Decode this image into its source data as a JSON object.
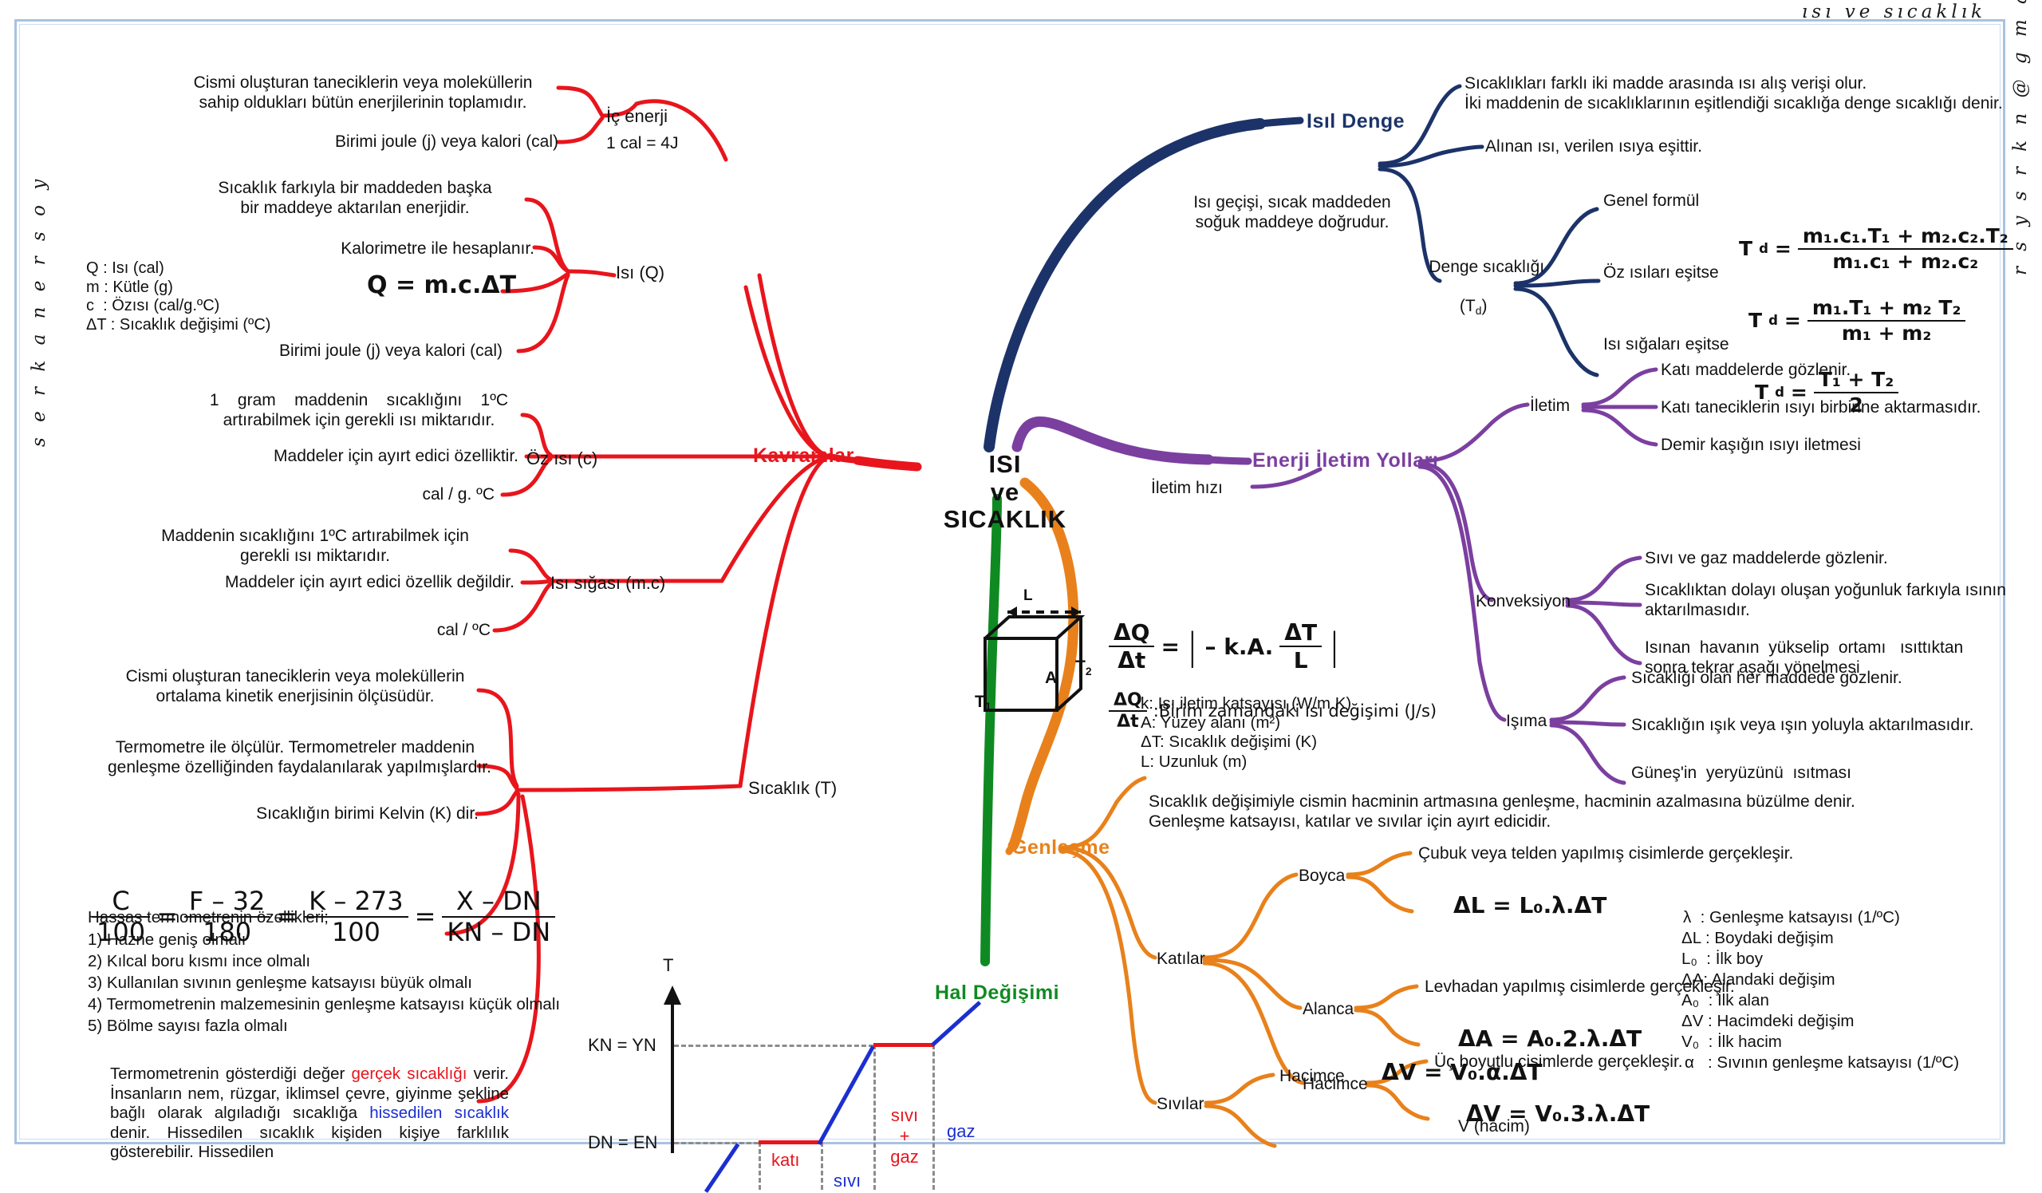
{
  "watermarks": {
    "top_right": "ısı  ve  sıcaklık",
    "left": "s e r k a n   e r s o y",
    "right": "r s y s r k n @ g m a i l . c o m"
  },
  "center": {
    "line1": "ISI",
    "line2": "ve",
    "line3": "SICAKLIK"
  },
  "branches": {
    "kavramlar": "Kavramlar",
    "isil_denge": "Isıl Denge",
    "enerji_iletim": "Enerji İletim Yolları",
    "genlesme": "Genleşme",
    "hal_degisimi": "Hal Değişimi"
  },
  "kavramlar": {
    "ic_enerji": {
      "label": "İç enerji",
      "sub": "1 cal = 4J",
      "desc1": "Cismi oluşturan taneciklerin veya moleküllerin\nsahip oldukları bütün enerjilerinin toplamıdır.",
      "desc2": "Birimi joule (j) veya kalori (cal)"
    },
    "isi_q": {
      "label": "Isı (Q)",
      "desc1": "Sıcaklık farkıyla bir maddeden başka\nbir maddeye aktarılan enerjidir.",
      "desc2": "Kalorimetre ile hesaplanır.",
      "desc3": "Birimi joule (j) veya kalori (cal)",
      "formula": "Q = m.c.ΔT",
      "legend": "Q : Isı (cal)\nm : Kütle (g)\nc  : Özısı (cal/g.ºC)\nΔT : Sıcaklık değişimi (ºC)"
    },
    "oz_isi": {
      "label": "Öz ısı (c)",
      "desc1": "1    gram    maddenin    sıcaklığını    1ºC\nartırabilmek için gerekli ısı miktarıdır.",
      "desc2": "Maddeler için ayırt edici özelliktir.",
      "desc3": "cal / g. ºC"
    },
    "isi_sigasi": {
      "label": "Isı sığası (m.c)",
      "desc1": "Maddenin sıcaklığını 1ºC artırabilmek için\ngerekli ısı miktarıdır.",
      "desc2": "Maddeler için ayırt edici özellik değildir.",
      "desc3": "cal / ºC"
    },
    "sicaklik_t": {
      "label": "Sıcaklık (T)",
      "desc1": "Cismi oluşturan taneciklerin veya moleküllerin\nortalama kinetik enerjisinin ölçüsüdür.",
      "desc2": "Termometre ile ölçülür. Termometreler maddenin\ngenleşme özelliğinden faydalanılarak yapılmışlardır.",
      "desc3": "Sıcaklığın birimi Kelvin (K) dir.",
      "scale_formula": {
        "n1": "C",
        "d1": "100",
        "n2": "F – 32",
        "d2": "180",
        "n3": "K – 273",
        "d3": "100",
        "n4": "X – DN",
        "d4": "KN – DN"
      },
      "props_title": "Hassas termometrenin özellikleri;",
      "props": [
        "1) Hazne geniş olmalı",
        "2) Kılcal boru kısmı ince olmalı",
        "3) Kullanılan sıvının genleşme katsayısı büyük olmalı",
        "4) Termometrenin malzemesinin genleşme katsayısı küçük olmalı",
        "5) Bölme sayısı fazla olmalı"
      ],
      "para": {
        "p1": "Termometrenin gösterdiği değer ",
        "hl1": "gerçek sıcaklığı",
        "p2": " verir. İnsanların nem, rüzgar, iklimsel çevre, giyinme şekline bağlı olarak algıladığı sıcaklığa ",
        "hl2": "hissedilen sıcaklık",
        "p3": " denir. Hissedilen sıcaklık kişiden kişiye farklılık gösterebilir. Hissedilen"
      }
    }
  },
  "isil_denge": {
    "desc_left": "Isı geçişi, sıcak maddeden\nsoğuk maddeye doğrudur.",
    "item1": "Sıcaklıkları farklı iki madde arasında ısı alış verişi olur.\nİki maddenin de sıcaklıklarının eşitlendiği sıcaklığa denge sıcaklığı denir.",
    "item2": "Alınan ısı, verilen ısıya eşittir.",
    "denge_label1": "Denge sıcaklığı",
    "denge_label2": "(T",
    "denge_label2b": "d",
    "denge_label2c": ")",
    "rows": [
      {
        "label": "Genel formül",
        "lhs": "T",
        "sub": "d",
        "num": "m₁.c₁.T₁ + m₂.c₂.T₂",
        "den": "m₁.c₁ + m₂.c₂"
      },
      {
        "label": "Öz ısıları eşitse",
        "lhs": "T",
        "sub": "d",
        "num": "m₁.T₁ + m₂ T₂",
        "den": "m₁ + m₂"
      },
      {
        "label": "Isı sığaları eşitse",
        "lhs": "T",
        "sub": "d",
        "num": "T₁ + T₂",
        "den": "2"
      }
    ]
  },
  "enerji_iletim": {
    "iletim_hizi": "İletim hızı",
    "rate_formula": {
      "n1": "ΔQ",
      "d1": "Δt",
      "eq": "=",
      "bar": "|",
      "body": "– k.A.",
      "n2": "ΔT",
      "d2": "L"
    },
    "explain_head_n": "ΔQ",
    "explain_head_d": "Δt",
    "explain_head_txt": ":Birim zamandaki ısı değişimi (J/s)",
    "explain_list": "k: Isı iletim katsayısı (W/m.K)\nA: Yüzey alanı (m²)\nΔT: Sıcaklık değişimi (K)\nL: Uzunluk (m)",
    "cube": {
      "L": "L",
      "A": "A",
      "T1": "T",
      "T1s": "1",
      "T2": "T",
      "T2s": "2"
    },
    "nodes": [
      {
        "label": "İletim",
        "items": [
          "Katı maddelerde gözlenir.",
          "Katı taneciklerin ısıyı birbirine aktarmasıdır.",
          "Demir kaşığın ısıyı iletmesi"
        ]
      },
      {
        "label": "Konveksiyon",
        "items": [
          "Sıvı ve gaz maddelerde gözlenir.",
          "Sıcaklıktan dolayı oluşan yoğunluk farkıyla ısının\naktarılmasıdır.",
          "Isınan  havanın  yükselip  ortamı   ısıttıktan\nsonra tekrar aşağı yönelmesi"
        ]
      },
      {
        "label": "Işıma",
        "items": [
          "Sıcaklığı olan her maddede gözlenir.",
          "Sıcaklığın ışık veya ışın yoluyla aktarılmasıdır.",
          "Güneş'in  yeryüzünü  ısıtması"
        ]
      }
    ]
  },
  "genlesme": {
    "intro": "Sıcaklık değişimiyle cismin hacminin artmasına genleşme, hacminin azalmasına büzülme denir.\nGenleşme katsayısı, katılar ve sıvılar için ayırt edicidir.",
    "katilar": "Katılar",
    "sivilar": "Sıvılar",
    "items": [
      {
        "label": "Boyca",
        "desc": "Çubuk veya telden yapılmış cisimlerde gerçekleşir.",
        "formula": "ΔL = L₀.λ.ΔT"
      },
      {
        "label": "Alanca",
        "desc": "Levhadan yapılmış cisimlerde gerçekleşir.",
        "formula": "ΔA = A₀.2.λ.ΔT"
      },
      {
        "label": "Hacimce",
        "desc": "Üç boyutlu cisimlerde gerçekleşir.",
        "formula": "ΔV = V₀.3.λ.ΔT"
      }
    ],
    "sivi_item": {
      "label": "Hacimce",
      "formula": "ΔV = V₀.α.ΔT",
      "note": "V (hacim)"
    },
    "legend": [
      "λ  : Genleşme katsayısı (1/ºC)",
      "ΔL : Boydaki değişim",
      "L₀  : İlk boy",
      "ΔA: Alandaki değişim",
      "A₀  : İlk alan",
      "ΔV : Hacimdeki değişim",
      "V₀  : İlk hacim",
      "α   : Sıvının genleşme katsayısı (1/ºC)"
    ]
  },
  "chart_data": {
    "type": "line",
    "title": "Hal Değişimi",
    "ylabel": "T",
    "xlabel": "",
    "grid": false,
    "ytick_labels": [
      "DN = EN",
      "KN = YN"
    ],
    "ytick_values": [
      1,
      2
    ],
    "segments": [
      {
        "phase": "katı-ısınma",
        "color": "#1b2fd0",
        "x0": 0.0,
        "y0": 0.2,
        "x1": 0.12,
        "y1": 1.0
      },
      {
        "phase": "katı (erime)",
        "color": "#e8151c",
        "x0": 0.12,
        "y0": 1.0,
        "x1": 0.38,
        "y1": 1.0
      },
      {
        "phase": "sıvı-ısınma",
        "color": "#1b2fd0",
        "x0": 0.38,
        "y0": 1.0,
        "x1": 0.66,
        "y1": 2.0
      },
      {
        "phase": "sıvı+gaz (kaynama)",
        "color": "#e8151c",
        "x0": 0.66,
        "y0": 2.0,
        "x1": 0.88,
        "y1": 2.0
      },
      {
        "phase": "gaz",
        "color": "#1b2fd0",
        "x0": 0.88,
        "y0": 2.0,
        "x1": 1.0,
        "y1": 2.45
      }
    ],
    "region_labels": [
      {
        "text": "katı",
        "color": "#e8151c",
        "x": 0.25
      },
      {
        "text": "sıvı",
        "color": "#1b2fd0",
        "x": 0.52
      },
      {
        "text": "sıvı\n+\ngaz",
        "color": "#e8151c",
        "x": 0.77
      },
      {
        "text": "gaz",
        "color": "#1b2fd0",
        "x": 0.95
      }
    ]
  }
}
